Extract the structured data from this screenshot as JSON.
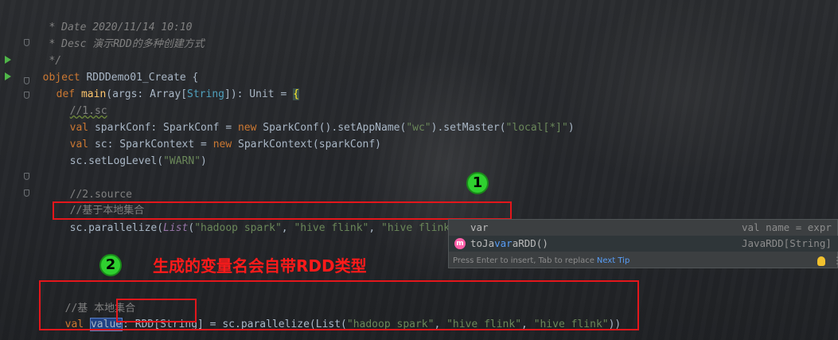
{
  "editor": {
    "lines": {
      "date_comment": " * Date 2020/11/14 10:10",
      "desc_prefix": " * Desc ",
      "desc_text": "演示RDD的多种创建方式",
      "comment_end": " */",
      "object_kw": "object",
      "object_name": " RDDDemo01_Create {",
      "def_kw": "def",
      "main_fn": "main",
      "main_args": "(args: Array[",
      "main_string": "String",
      "main_ret": "]): Unit = ",
      "main_brace": "{",
      "sc_comment": "//1.sc",
      "sparkconf_val": "val",
      "sparkconf_decl": " sparkConf: SparkConf = ",
      "sparkconf_new": "new",
      "sparkconf_call1": " SparkConf().setAppName(",
      "sparkconf_wc": "\"wc\"",
      "sparkconf_call2": ").setMaster(",
      "sparkconf_local": "\"local[*]\"",
      "sparkconf_end": ")",
      "sc_val": "val",
      "sc_decl": " sc: SparkContext = ",
      "sc_new": "new",
      "sc_call": " SparkContext(sparkConf)",
      "loglevel_call": "sc.setLogLevel(",
      "loglevel_arg": "\"WARN\"",
      "loglevel_end": ")",
      "source_comment": "//2.source",
      "local_set_comment": "//基于本地集合",
      "parallelize_prefix": "sc.parallelize(",
      "parallelize_list": "List",
      "parallelize_open": "(",
      "parallelize_s1": "\"hadoop spark\"",
      "parallelize_comma1": ", ",
      "parallelize_s2": "\"hive flink\"",
      "parallelize_comma2": ", ",
      "parallelize_s3": "\"hive flink\"",
      "parallelize_close": ")).",
      "parallelize_var": "var",
      "result_comment_a": "//基",
      "result_comment_b": "本地集合",
      "result_val": "val",
      "result_name": "value",
      "result_colon": ": ",
      "result_type": "RDD[String]",
      "result_rest_a": " = sc.parallelize(List(",
      "result_s1": "\"hadoop spark\"",
      "result_comma1": ", ",
      "result_s2": "\"hive flink\"",
      "result_comma2": ", ",
      "result_s3": "\"hive flink\"",
      "result_end": "))"
    }
  },
  "completion_popup": {
    "items": [
      {
        "name": "var",
        "match": "",
        "rest": "",
        "right": "val name = expr",
        "icon": ""
      },
      {
        "name_pre": "toJa",
        "match": "var",
        "name_post": "aRDD()",
        "right": "JavaRDD[String]",
        "icon": "m"
      }
    ],
    "footer_text": "Press Enter to insert, Tab to replace",
    "footer_tip": "Next Tip",
    "menu_glyph": "⋮"
  },
  "annotations": {
    "badge_1": "1",
    "badge_2": "2",
    "caption": "生成的变量名会自带RDD类型"
  },
  "colors": {
    "highlight_box": "#e4161b",
    "badge_fill": "#2fd02f",
    "caption": "#ff1a1a"
  },
  "icons": {
    "run": "run-triangle-icon",
    "method": "method-m-icon",
    "bulb": "lightbulb-icon"
  }
}
